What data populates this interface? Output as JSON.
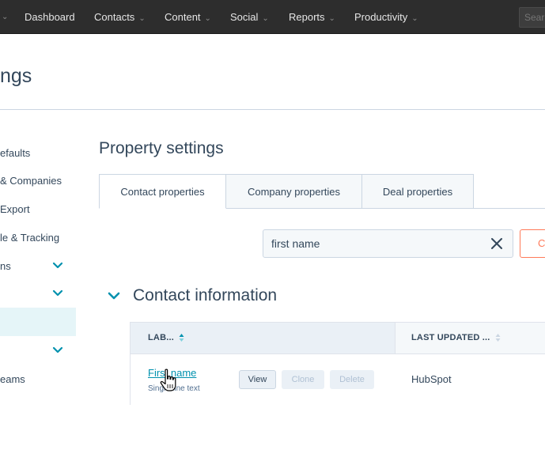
{
  "topnav": {
    "items": [
      {
        "label": "Dashboard",
        "has_caret": false
      },
      {
        "label": "Contacts",
        "has_caret": true
      },
      {
        "label": "Content",
        "has_caret": true
      },
      {
        "label": "Social",
        "has_caret": true
      },
      {
        "label": "Reports",
        "has_caret": true
      },
      {
        "label": "Productivity",
        "has_caret": true
      }
    ],
    "search_placeholder": "Sear",
    "caret_glyph": "⌄"
  },
  "page": {
    "title": "ngs"
  },
  "sidebar": {
    "items": [
      {
        "label": "efaults",
        "has_chevron": false
      },
      {
        "label": "& Companies",
        "has_chevron": false
      },
      {
        "label": "Export",
        "has_chevron": false
      },
      {
        "label": "le & Tracking",
        "has_chevron": false
      },
      {
        "label": "ns",
        "has_chevron": true
      },
      {
        "label": "",
        "has_chevron": true
      },
      {
        "label": "",
        "has_chevron": false,
        "active": true
      },
      {
        "label": "",
        "has_chevron": true
      },
      {
        "label": "eams",
        "has_chevron": false
      }
    ]
  },
  "main": {
    "title": "Property settings",
    "tabs": [
      {
        "label": "Contact properties",
        "active": true
      },
      {
        "label": "Company properties",
        "active": false
      },
      {
        "label": "Deal properties",
        "active": false
      }
    ],
    "search": {
      "value": "first name",
      "clear_icon": "close-icon"
    },
    "create_button_label": "C",
    "section": {
      "title": "Contact information",
      "expanded": true
    },
    "table": {
      "columns": [
        {
          "label": "LAB...",
          "sort_state": "ascending"
        },
        {
          "label": "LAST UPDATED ...",
          "sort_state": "none"
        }
      ],
      "rows": [
        {
          "label": "First name",
          "field_type": "Single-line text",
          "actions": [
            {
              "label": "View",
              "enabled": true
            },
            {
              "label": "Clone",
              "enabled": false
            },
            {
              "label": "Delete",
              "enabled": false
            }
          ],
          "last_updated": "HubSpot"
        }
      ]
    }
  },
  "colors": {
    "nav_bg": "#2d2d2d",
    "accent": "#0091ae",
    "create_accent": "#ff7a59",
    "text": "#33475b",
    "active_sidebar": "#e5f5f8"
  }
}
